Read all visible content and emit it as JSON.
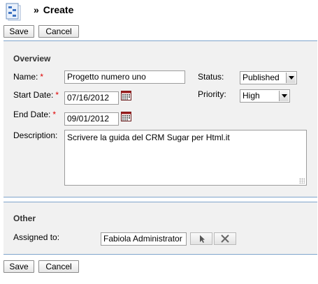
{
  "header": {
    "title": "Create",
    "chevron": "»",
    "icon": "project-module-icon"
  },
  "toolbar_top": {
    "save_label": "Save",
    "cancel_label": "Cancel"
  },
  "overview": {
    "title": "Overview",
    "name": {
      "label": "Name:",
      "required": "*",
      "value": "Progetto numero uno"
    },
    "start_date": {
      "label": "Start Date:",
      "required": "*",
      "value": "07/16/2012",
      "icon": "calendar-icon"
    },
    "end_date": {
      "label": "End Date:",
      "required": "*",
      "value": "09/01/2012",
      "icon": "calendar-icon"
    },
    "description": {
      "label": "Description:",
      "value": "Scrivere la guida del CRM Sugar per Html.it"
    },
    "status": {
      "label": "Status:",
      "value": "Published"
    },
    "priority": {
      "label": "Priority:",
      "value": "High"
    }
  },
  "other": {
    "title": "Other",
    "assigned_to": {
      "label": "Assigned to:",
      "value": "Fabiola Administrator",
      "select_icon": "cursor-arrow-icon",
      "clear_icon": "close-x-icon"
    }
  },
  "toolbar_bottom": {
    "save_label": "Save",
    "cancel_label": "Cancel"
  },
  "colors": {
    "panel_bg": "#f1f1f1",
    "panel_border": "#7fa4cc",
    "required": "#e00000"
  }
}
